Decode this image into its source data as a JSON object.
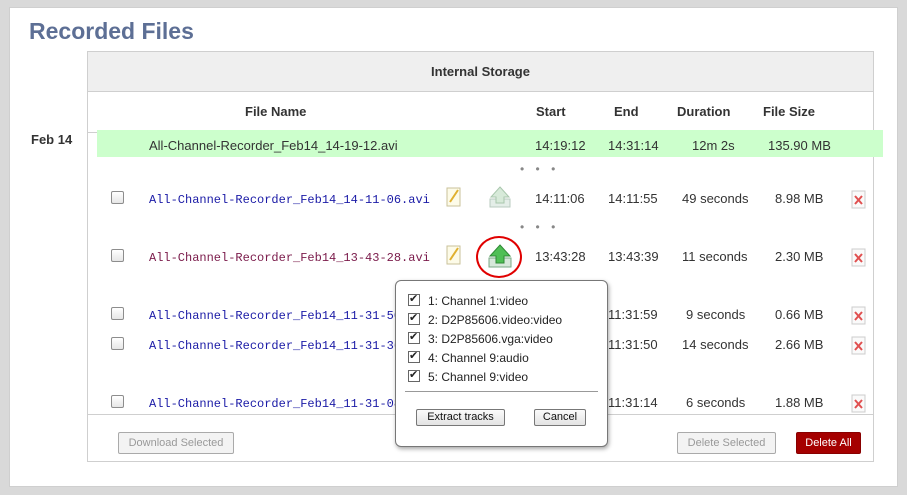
{
  "page": {
    "title": "Recorded Files"
  },
  "storage": {
    "label": "Internal Storage"
  },
  "columns": {
    "filename": "File Name",
    "start": "Start",
    "end": "End",
    "duration": "Duration",
    "size": "File Size"
  },
  "date_group": "Feb 14",
  "current": {
    "name": "All-Channel-Recorder_Feb14_14-19-12.avi",
    "start": "14:19:12",
    "end": "14:31:14",
    "duration": "12m 2s",
    "size": "135.90 MB"
  },
  "files": [
    {
      "name": "All-Channel-Recorder_Feb14_14-11-06.avi",
      "start": "14:11:06",
      "end": "14:11:55",
      "duration": "49 seconds",
      "size": "8.98 MB"
    },
    {
      "name": "All-Channel-Recorder_Feb14_13-43-28.avi",
      "start": "13:43:28",
      "end": "13:43:39",
      "duration": "11 seconds",
      "size": "2.30 MB"
    },
    {
      "name": "All-Channel-Recorder_Feb14_11-31-50",
      "start": "",
      "end": "11:31:59",
      "duration": "9 seconds",
      "size": "0.66 MB"
    },
    {
      "name": "All-Channel-Recorder_Feb14_11-31-36",
      "start": "",
      "end": "11:31:50",
      "duration": "14 seconds",
      "size": "2.66 MB"
    },
    {
      "name": "All-Channel-Recorder_Feb14_11-31-08",
      "start": "",
      "end": "11:31:14",
      "duration": "6 seconds",
      "size": "1.88 MB"
    }
  ],
  "separator": "• • •",
  "tracks": [
    {
      "label": "1: Channel 1:video"
    },
    {
      "label": "2: D2P85606.video:video"
    },
    {
      "label": "3: D2P85606.vga:video"
    },
    {
      "label": "4: Channel 9:audio"
    },
    {
      "label": "5: Channel 9:video"
    }
  ],
  "popup": {
    "extract": "Extract tracks",
    "cancel": "Cancel"
  },
  "buttons": {
    "download": "Download Selected",
    "delete_selected": "Delete Selected",
    "delete_all": "Delete All"
  },
  "colors": {
    "title": "#5d6f95",
    "current_row": "#ccffcc",
    "danger": "#a50000",
    "highlight": "#e00000"
  }
}
